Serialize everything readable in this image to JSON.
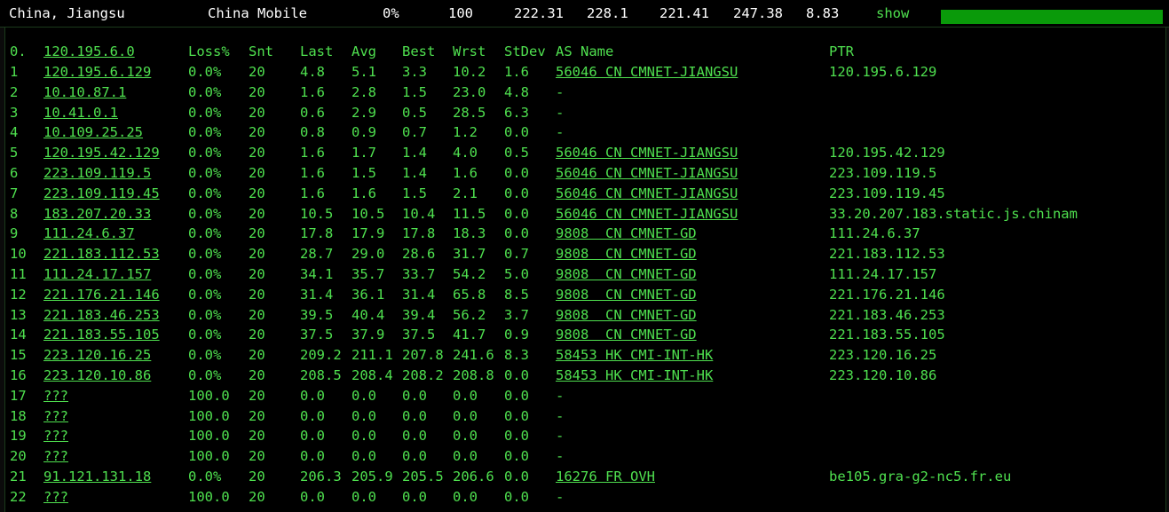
{
  "summary": {
    "location": "China, Jiangsu",
    "isp": "China Mobile",
    "loss": "0%",
    "sent": "100",
    "last": "222.31",
    "avg": "228.1",
    "best": "221.41",
    "worst": "247.38",
    "stdev": "8.83",
    "show_label": "show",
    "progress_fraction": 1.0,
    "progress_color": "#0a9a0a"
  },
  "columns": {
    "idx": "0.",
    "host": "120.195.6.0",
    "loss": "Loss%",
    "snt": "Snt",
    "last": "Last",
    "avg": "Avg",
    "best": "Best",
    "wrst": "Wrst",
    "stdev": "StDev",
    "as": "AS Name",
    "ptr": "PTR"
  },
  "hops": [
    {
      "idx": "1",
      "host": "120.195.6.129",
      "loss": "0.0%",
      "snt": "20",
      "last": "4.8",
      "avg": "5.1",
      "best": "3.3",
      "wrst": "10.2",
      "stdev": "1.6",
      "as": "56046 CN CMNET-JIANGSU",
      "ptr": "120.195.6.129"
    },
    {
      "idx": "2",
      "host": "10.10.87.1",
      "loss": "0.0%",
      "snt": "20",
      "last": "1.6",
      "avg": "2.8",
      "best": "1.5",
      "wrst": "23.0",
      "stdev": "4.8",
      "as": "-",
      "ptr": ""
    },
    {
      "idx": "3",
      "host": "10.41.0.1",
      "loss": "0.0%",
      "snt": "20",
      "last": "0.6",
      "avg": "2.9",
      "best": "0.5",
      "wrst": "28.5",
      "stdev": "6.3",
      "as": "-",
      "ptr": ""
    },
    {
      "idx": "4",
      "host": "10.109.25.25",
      "loss": "0.0%",
      "snt": "20",
      "last": "0.8",
      "avg": "0.9",
      "best": "0.7",
      "wrst": "1.2",
      "stdev": "0.0",
      "as": "-",
      "ptr": ""
    },
    {
      "idx": "5",
      "host": "120.195.42.129",
      "loss": "0.0%",
      "snt": "20",
      "last": "1.6",
      "avg": "1.7",
      "best": "1.4",
      "wrst": "4.0",
      "stdev": "0.5",
      "as": "56046 CN CMNET-JIANGSU",
      "ptr": "120.195.42.129"
    },
    {
      "idx": "6",
      "host": "223.109.119.5",
      "loss": "0.0%",
      "snt": "20",
      "last": "1.6",
      "avg": "1.5",
      "best": "1.4",
      "wrst": "1.6",
      "stdev": "0.0",
      "as": "56046 CN CMNET-JIANGSU",
      "ptr": "223.109.119.5"
    },
    {
      "idx": "7",
      "host": "223.109.119.45",
      "loss": "0.0%",
      "snt": "20",
      "last": "1.6",
      "avg": "1.6",
      "best": "1.5",
      "wrst": "2.1",
      "stdev": "0.0",
      "as": "56046 CN CMNET-JIANGSU",
      "ptr": "223.109.119.45"
    },
    {
      "idx": "8",
      "host": "183.207.20.33",
      "loss": "0.0%",
      "snt": "20",
      "last": "10.5",
      "avg": "10.5",
      "best": "10.4",
      "wrst": "11.5",
      "stdev": "0.0",
      "as": "56046 CN CMNET-JIANGSU",
      "ptr": "33.20.207.183.static.js.chinam"
    },
    {
      "idx": "9",
      "host": "111.24.6.37",
      "loss": "0.0%",
      "snt": "20",
      "last": "17.8",
      "avg": "17.9",
      "best": "17.8",
      "wrst": "18.3",
      "stdev": "0.0",
      "as": "9808  CN CMNET-GD",
      "ptr": "111.24.6.37"
    },
    {
      "idx": "10",
      "host": "221.183.112.53",
      "loss": "0.0%",
      "snt": "20",
      "last": "28.7",
      "avg": "29.0",
      "best": "28.6",
      "wrst": "31.7",
      "stdev": "0.7",
      "as": "9808  CN CMNET-GD",
      "ptr": "221.183.112.53"
    },
    {
      "idx": "11",
      "host": "111.24.17.157",
      "loss": "0.0%",
      "snt": "20",
      "last": "34.1",
      "avg": "35.7",
      "best": "33.7",
      "wrst": "54.2",
      "stdev": "5.0",
      "as": "9808  CN CMNET-GD",
      "ptr": "111.24.17.157"
    },
    {
      "idx": "12",
      "host": "221.176.21.146",
      "loss": "0.0%",
      "snt": "20",
      "last": "31.4",
      "avg": "36.1",
      "best": "31.4",
      "wrst": "65.8",
      "stdev": "8.5",
      "as": "9808  CN CMNET-GD",
      "ptr": "221.176.21.146"
    },
    {
      "idx": "13",
      "host": "221.183.46.253",
      "loss": "0.0%",
      "snt": "20",
      "last": "39.5",
      "avg": "40.4",
      "best": "39.4",
      "wrst": "56.2",
      "stdev": "3.7",
      "as": "9808  CN CMNET-GD",
      "ptr": "221.183.46.253"
    },
    {
      "idx": "14",
      "host": "221.183.55.105",
      "loss": "0.0%",
      "snt": "20",
      "last": "37.5",
      "avg": "37.9",
      "best": "37.5",
      "wrst": "41.7",
      "stdev": "0.9",
      "as": "9808  CN CMNET-GD",
      "ptr": "221.183.55.105"
    },
    {
      "idx": "15",
      "host": "223.120.16.25",
      "loss": "0.0%",
      "snt": "20",
      "last": "209.2",
      "avg": "211.1",
      "best": "207.8",
      "wrst": "241.6",
      "stdev": "8.3",
      "as": "58453 HK CMI-INT-HK",
      "ptr": "223.120.16.25"
    },
    {
      "idx": "16",
      "host": "223.120.10.86",
      "loss": "0.0%",
      "snt": "20",
      "last": "208.5",
      "avg": "208.4",
      "best": "208.2",
      "wrst": "208.8",
      "stdev": "0.0",
      "as": "58453 HK CMI-INT-HK",
      "ptr": "223.120.10.86"
    },
    {
      "idx": "17",
      "host": "???",
      "loss": "100.0",
      "snt": "20",
      "last": "0.0",
      "avg": "0.0",
      "best": "0.0",
      "wrst": "0.0",
      "stdev": "0.0",
      "as": "-",
      "ptr": ""
    },
    {
      "idx": "18",
      "host": "???",
      "loss": "100.0",
      "snt": "20",
      "last": "0.0",
      "avg": "0.0",
      "best": "0.0",
      "wrst": "0.0",
      "stdev": "0.0",
      "as": "-",
      "ptr": ""
    },
    {
      "idx": "19",
      "host": "???",
      "loss": "100.0",
      "snt": "20",
      "last": "0.0",
      "avg": "0.0",
      "best": "0.0",
      "wrst": "0.0",
      "stdev": "0.0",
      "as": "-",
      "ptr": ""
    },
    {
      "idx": "20",
      "host": "???",
      "loss": "100.0",
      "snt": "20",
      "last": "0.0",
      "avg": "0.0",
      "best": "0.0",
      "wrst": "0.0",
      "stdev": "0.0",
      "as": "-",
      "ptr": ""
    },
    {
      "idx": "21",
      "host": "91.121.131.18",
      "loss": "0.0%",
      "snt": "20",
      "last": "206.3",
      "avg": "205.9",
      "best": "205.5",
      "wrst": "206.6",
      "stdev": "0.0",
      "as": "16276 FR OVH",
      "ptr": "be105.gra-g2-nc5.fr.eu"
    },
    {
      "idx": "22",
      "host": "???",
      "loss": "100.0",
      "snt": "20",
      "last": "0.0",
      "avg": "0.0",
      "best": "0.0",
      "wrst": "0.0",
      "stdev": "0.0",
      "as": "-",
      "ptr": ""
    }
  ]
}
